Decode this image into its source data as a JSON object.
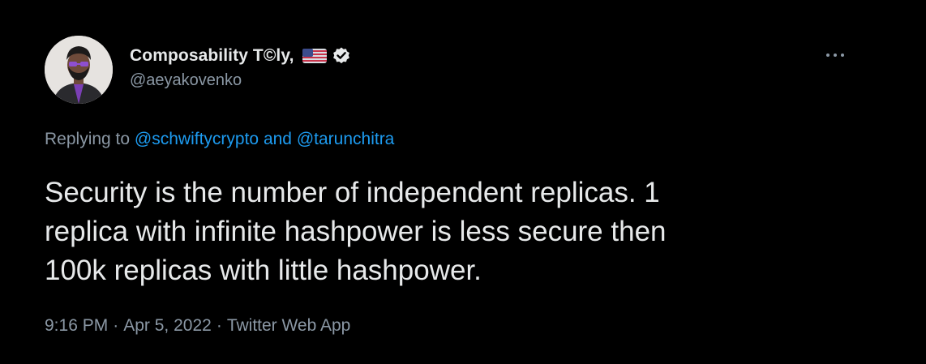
{
  "user": {
    "display_name": "Composability T©ly,",
    "handle": "@aeyakovenko",
    "flag_icon": "us-flag-icon",
    "verified_icon": "verified-badge-icon"
  },
  "menu": {
    "more_icon": "more-horizontal-icon",
    "more_label": "···"
  },
  "reply": {
    "prefix": "Replying to",
    "mention_1": "@schwiftycrypto",
    "joiner": "and",
    "mention_2": "@tarunchitra"
  },
  "tweet": {
    "text_line_1": "Security is the number of independent replicas. 1",
    "text_line_2": "replica with infinite hashpower is less secure then",
    "text_line_3": "100k replicas with little hashpower."
  },
  "meta": {
    "time": "9:16 PM",
    "date": "Apr 5, 2022",
    "source": "Twitter Web App",
    "separator": "·"
  },
  "colors": {
    "background": "#000000",
    "text_primary": "#e7e9ea",
    "text_secondary": "#8b98a5",
    "link": "#1d9bf0"
  }
}
